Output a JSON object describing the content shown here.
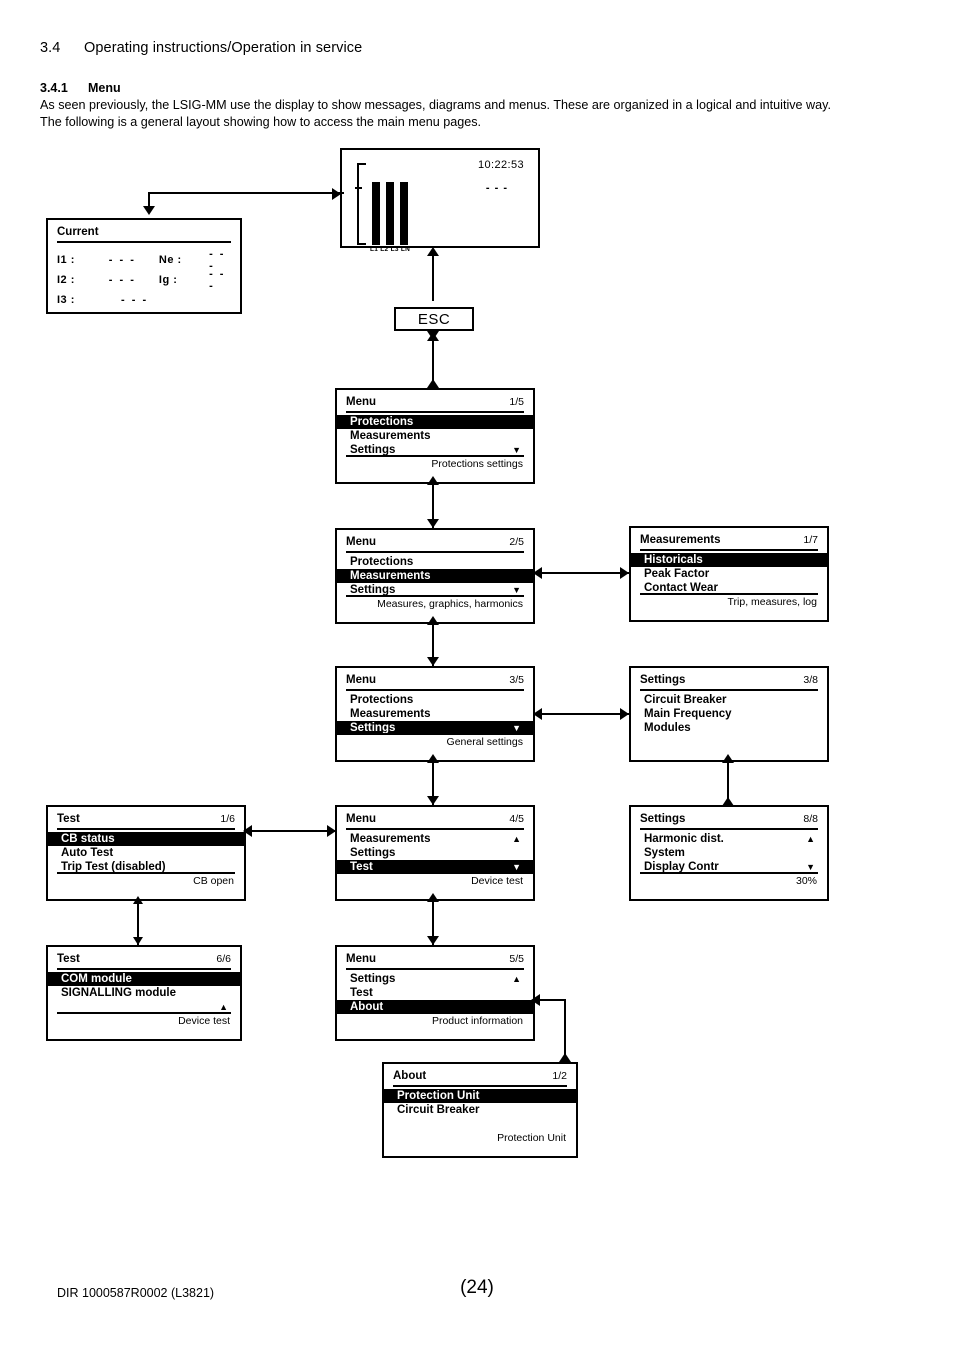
{
  "document": {
    "section_number": "3.4",
    "section_title": "Operating instructions/Operation in service",
    "subsection_number": "3.4.1",
    "subsection_title": "Menu",
    "intro_line1": "As seen previously, the LSIG-MM use the display to show messages, diagrams and menus. These are organized in a logical and intuitive way.",
    "intro_line2": "The following is a general layout showing how to access the main menu pages.",
    "footer_code": "DIR 1000587R0002 (L3821)",
    "page_number": "(24)"
  },
  "esc_button": {
    "label": "ESC"
  },
  "bargraph_display": {
    "time": "10:22:53",
    "dashes": "- - -",
    "phase_labels": "L1 L2 L3 LN",
    "bars": [
      {
        "label": "L1",
        "height_pct": 100
      },
      {
        "label": "L2",
        "height_pct": 100
      },
      {
        "label": "L3",
        "height_pct": 100
      }
    ]
  },
  "current_panel": {
    "title": "Current",
    "rows": [
      {
        "label": "I1 :",
        "value": "- - -",
        "label2": "Ne :",
        "value2": "- - -"
      },
      {
        "label": "I2 :",
        "value": "- - -",
        "label2": "Ig :",
        "value2": "- - -"
      },
      {
        "label": "I3 :",
        "value": "- - -",
        "label2": "",
        "value2": ""
      }
    ]
  },
  "panels": {
    "menu_1_5": {
      "title": "Menu",
      "page": "1/5",
      "rows": [
        {
          "label": "Protections",
          "selected": true,
          "arrow": ""
        },
        {
          "label": "Measurements",
          "selected": false,
          "arrow": ""
        },
        {
          "label": "Settings",
          "selected": false,
          "arrow": "▼"
        }
      ],
      "status": "Protections settings"
    },
    "menu_2_5": {
      "title": "Menu",
      "page": "2/5",
      "rows": [
        {
          "label": "Protections",
          "selected": false,
          "arrow": ""
        },
        {
          "label": "Measurements",
          "selected": true,
          "arrow": ""
        },
        {
          "label": "Settings",
          "selected": false,
          "arrow": "▼"
        }
      ],
      "status": "Measures, graphics, harmonics"
    },
    "menu_3_5": {
      "title": "Menu",
      "page": "3/5",
      "rows": [
        {
          "label": "Protections",
          "selected": false,
          "arrow": ""
        },
        {
          "label": "Measurements",
          "selected": false,
          "arrow": ""
        },
        {
          "label": "Settings",
          "selected": true,
          "arrow": "▼"
        }
      ],
      "status": "General settings"
    },
    "menu_4_5": {
      "title": "Menu",
      "page": "4/5",
      "rows": [
        {
          "label": "Measurements",
          "selected": false,
          "arrow": "▲"
        },
        {
          "label": "Settings",
          "selected": false,
          "arrow": ""
        },
        {
          "label": "Test",
          "selected": true,
          "arrow": "▼"
        }
      ],
      "status": "Device test"
    },
    "menu_5_5": {
      "title": "Menu",
      "page": "5/5",
      "rows": [
        {
          "label": "Settings",
          "selected": false,
          "arrow": "▲"
        },
        {
          "label": "Test",
          "selected": false,
          "arrow": ""
        },
        {
          "label": "About",
          "selected": true,
          "arrow": ""
        }
      ],
      "status": "Product information"
    },
    "measurements_1_7": {
      "title": "Measurements",
      "page": "1/7",
      "rows": [
        {
          "label": "Historicals",
          "selected": true,
          "arrow": ""
        },
        {
          "label": "Peak Factor",
          "selected": false,
          "arrow": ""
        },
        {
          "label": "Contact Wear",
          "selected": false,
          "arrow": ""
        }
      ],
      "status": "Trip, measures, log"
    },
    "settings_3_8": {
      "title": "Settings",
      "page": "3/8",
      "rows": [
        {
          "label": "Circuit Breaker",
          "selected": false,
          "arrow": ""
        },
        {
          "label": "Main Frequency",
          "selected": false,
          "arrow": ""
        },
        {
          "label": "Modules",
          "selected": false,
          "arrow": ""
        }
      ],
      "status": ""
    },
    "settings_8_8": {
      "title": "Settings",
      "page": "8/8",
      "rows": [
        {
          "label": "Harmonic dist.",
          "selected": false,
          "arrow": "▲"
        },
        {
          "label": "System",
          "selected": false,
          "arrow": ""
        },
        {
          "label": "Display Contr",
          "selected": false,
          "arrow": "▼"
        }
      ],
      "status": "30%"
    },
    "test_1_6": {
      "title": "Test",
      "page": "1/6",
      "rows": [
        {
          "label": "CB status",
          "selected": true,
          "arrow": ""
        },
        {
          "label": "Auto Test",
          "selected": false,
          "arrow": ""
        },
        {
          "label": "Trip Test (disabled)",
          "selected": false,
          "arrow": ""
        }
      ],
      "status": "CB open"
    },
    "test_6_6": {
      "title": "Test",
      "page": "6/6",
      "rows": [
        {
          "label": "COM module",
          "selected": true,
          "arrow": ""
        },
        {
          "label": "SIGNALLING module",
          "selected": false,
          "arrow": ""
        },
        {
          "label": "",
          "selected": false,
          "arrow": "▲"
        }
      ],
      "status": "Device test"
    },
    "about_1_2": {
      "title": "About",
      "page": "1/2",
      "rows": [
        {
          "label": "Protection Unit",
          "selected": true,
          "arrow": ""
        },
        {
          "label": "Circuit Breaker",
          "selected": false,
          "arrow": ""
        },
        {
          "label": "",
          "selected": false,
          "arrow": ""
        }
      ],
      "status": "Protection Unit"
    }
  }
}
